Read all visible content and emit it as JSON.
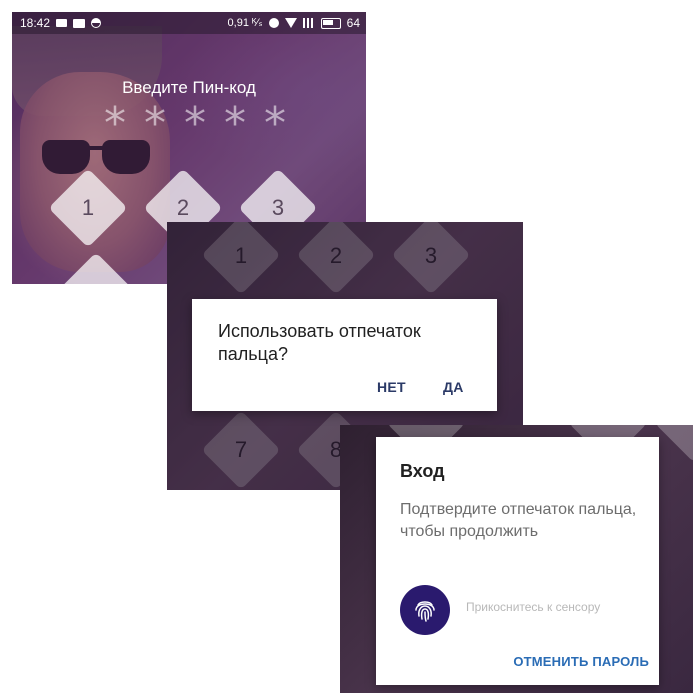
{
  "screen1": {
    "status": {
      "time": "18:42",
      "data_rate": "0,91 ᴷ⁄ₛ",
      "battery": "64"
    },
    "status_icons": [
      "message-icon",
      "image-icon",
      "half-circle-icon",
      "alarm-icon",
      "wifi-icon",
      "signal-icon",
      "battery-icon"
    ],
    "title": "Введите Пин-код",
    "pin_dots": [
      "*",
      "*",
      "*",
      "*",
      "*"
    ],
    "keys": [
      "1",
      "2",
      "3"
    ]
  },
  "screen2": {
    "keys_top": [
      "1",
      "2",
      "3"
    ],
    "keys_bottom": [
      "7",
      "8"
    ],
    "dialog": {
      "message": "Использовать отпечаток пальца?",
      "no_label": "НЕТ",
      "yes_label": "ДА"
    }
  },
  "screen3": {
    "dialog": {
      "title": "Вход",
      "message": "Подтвердите отпечаток пальца, чтобы продолжить",
      "hint": "Прикоснитесь к сенсору",
      "cancel_label": "ОТМЕНИТЬ",
      "password_label": "ПАРОЛЬ"
    },
    "accent": "#2a1a6e"
  }
}
